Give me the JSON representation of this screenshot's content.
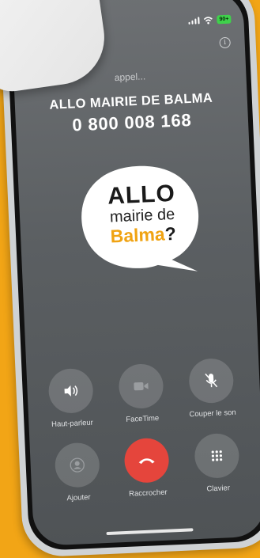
{
  "call": {
    "status": "appel...",
    "caller_name": "ALLO MAIRIE DE BALMA",
    "caller_number": "0 800 008 168"
  },
  "statusbar": {
    "battery": "90+"
  },
  "logo": {
    "line1": "ALLO",
    "line2": "mairie de",
    "line3": "Balma",
    "line3_suffix": "?"
  },
  "controls": {
    "speaker": "Haut-parleur",
    "facetime": "FaceTime",
    "mute": "Couper le son",
    "add": "Ajouter",
    "end": "Raccrocher",
    "keypad": "Clavier"
  },
  "colors": {
    "background": "#f2a516",
    "end_call": "#e5453c",
    "brand_orange": "#f0a312",
    "battery": "#3fd14b"
  }
}
